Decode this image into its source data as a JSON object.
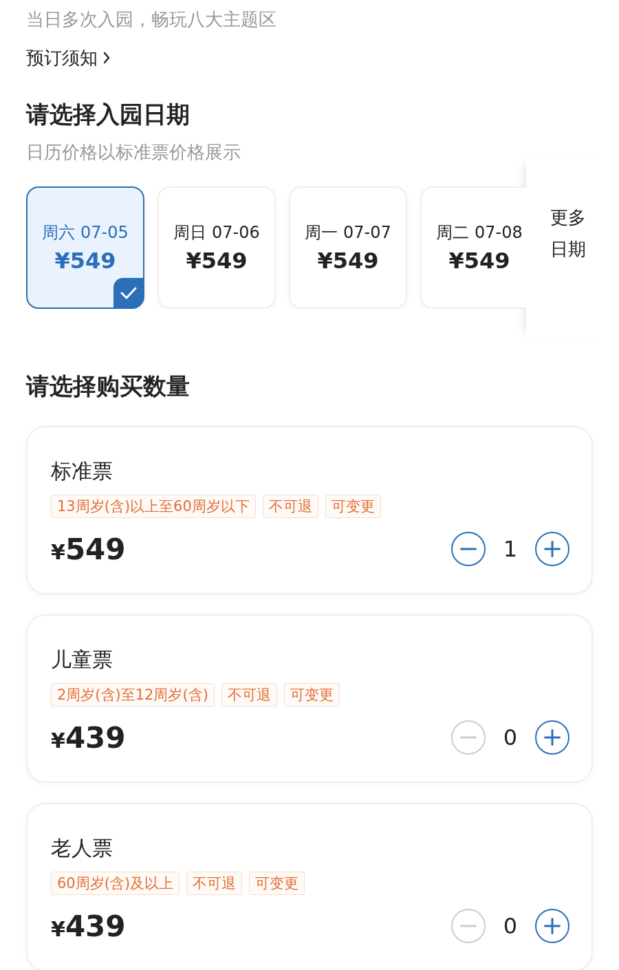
{
  "intro": {
    "text": "当日多次入园，畅玩八大主题区",
    "notice_link": "预订须知"
  },
  "date_section": {
    "title": "请选择入园日期",
    "subtitle": "日历价格以标准票价格展示",
    "dates": [
      {
        "weekday": "周六",
        "date": "07-05",
        "price": "¥549",
        "selected": true
      },
      {
        "weekday": "周日",
        "date": "07-06",
        "price": "¥549",
        "selected": false
      },
      {
        "weekday": "周一",
        "date": "07-07",
        "price": "¥549",
        "selected": false
      },
      {
        "weekday": "周二",
        "date": "07-08",
        "price": "¥549",
        "selected": false
      }
    ],
    "more_dates": "更多日期"
  },
  "quantity_section": {
    "title": "请选择购买数量",
    "tickets": [
      {
        "name": "标准票",
        "tags": [
          "13周岁(含)以上至60周岁以下",
          "不可退",
          "可变更"
        ],
        "price": "549",
        "currency": "¥",
        "quantity": "1",
        "decrement_disabled": false
      },
      {
        "name": "儿童票",
        "tags": [
          "2周岁(含)至12周岁(含)",
          "不可退",
          "可变更"
        ],
        "price": "439",
        "currency": "¥",
        "quantity": "0",
        "decrement_disabled": true
      },
      {
        "name": "老人票",
        "tags": [
          "60周岁(含)及以上",
          "不可退",
          "可变更"
        ],
        "price": "439",
        "currency": "¥",
        "quantity": "0",
        "decrement_disabled": true
      }
    ]
  }
}
